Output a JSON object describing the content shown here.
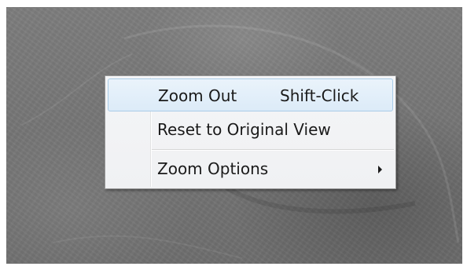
{
  "context_menu": {
    "items": [
      {
        "label": "Zoom Out",
        "shortcut": "Shift-Click",
        "highlighted": true
      },
      {
        "label": "Reset to Original View"
      },
      {
        "label": "Zoom Options",
        "has_submenu": true
      }
    ]
  },
  "colors": {
    "menu_background": "#f0f1f3",
    "menu_border": "#979797",
    "highlight_background": "#dcebf8",
    "highlight_border": "#a9cce8",
    "image_background": "#767676"
  }
}
